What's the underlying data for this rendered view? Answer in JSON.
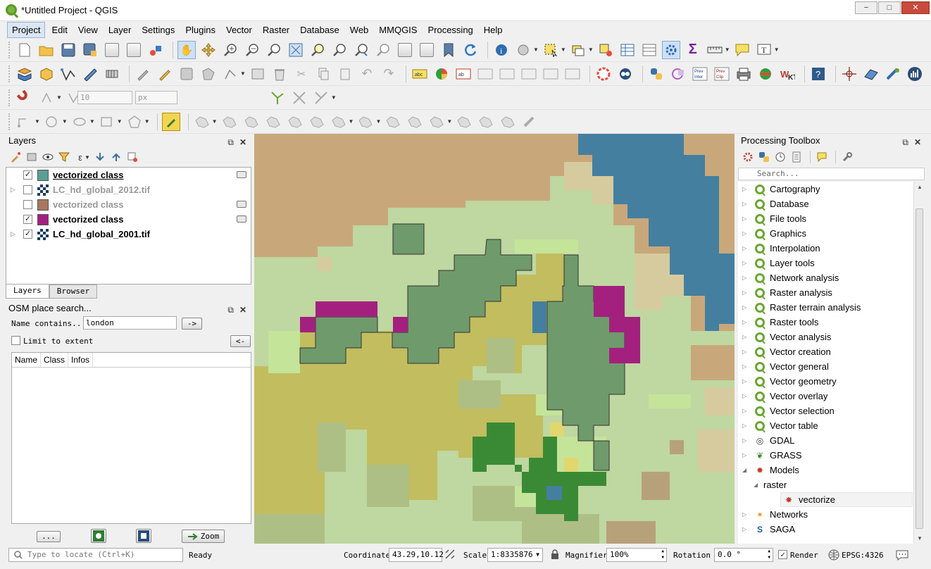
{
  "window": {
    "title": "*Untitled Project - QGIS",
    "minimize": "−",
    "maximize": "□",
    "close": "✕"
  },
  "menu": [
    "Project",
    "Edit",
    "View",
    "Layer",
    "Settings",
    "Plugins",
    "Vector",
    "Raster",
    "Database",
    "Web",
    "MMQGIS",
    "Processing",
    "Help"
  ],
  "toolbar": {
    "snapping_tolerance": "10",
    "snapping_units": "px"
  },
  "layers_panel": {
    "title": "Layers",
    "layers": [
      {
        "name": "vectorized class",
        "checked": true,
        "type": "vector",
        "color": "#5a9e95",
        "style": "bold-underline"
      },
      {
        "name": "LC_hd_global_2012.tif",
        "checked": false,
        "type": "raster",
        "style": "grey"
      },
      {
        "name": "vectorized class",
        "checked": false,
        "type": "vector",
        "color": "#a8775e",
        "style": "grey"
      },
      {
        "name": "vectorized class",
        "checked": true,
        "type": "vector",
        "color": "#a3207f",
        "style": "bold"
      },
      {
        "name": "LC_hd_global_2001.tif",
        "checked": true,
        "type": "raster",
        "style": "bold"
      }
    ],
    "tabs": [
      "Layers",
      "Browser"
    ]
  },
  "osm_panel": {
    "title": "OSM place search...",
    "name_contains_label": "Name contains...",
    "name_value": "london",
    "search_button": "->",
    "limit_label": "Limit to extent",
    "back_button": "<-",
    "columns": [
      "Name",
      "Class",
      "Infos"
    ],
    "more_button": "...",
    "zoom_button": "Zoom"
  },
  "processing": {
    "title": "Processing Toolbox",
    "search_placeholder": "Search...",
    "items": [
      {
        "label": "Cartography",
        "icon": "qgis"
      },
      {
        "label": "Database",
        "icon": "qgis"
      },
      {
        "label": "File tools",
        "icon": "qgis"
      },
      {
        "label": "Graphics",
        "icon": "qgis"
      },
      {
        "label": "Interpolation",
        "icon": "qgis"
      },
      {
        "label": "Layer tools",
        "icon": "qgis"
      },
      {
        "label": "Network analysis",
        "icon": "qgis"
      },
      {
        "label": "Raster analysis",
        "icon": "qgis"
      },
      {
        "label": "Raster terrain analysis",
        "icon": "qgis"
      },
      {
        "label": "Raster tools",
        "icon": "qgis"
      },
      {
        "label": "Vector analysis",
        "icon": "qgis"
      },
      {
        "label": "Vector creation",
        "icon": "qgis"
      },
      {
        "label": "Vector general",
        "icon": "qgis"
      },
      {
        "label": "Vector geometry",
        "icon": "qgis"
      },
      {
        "label": "Vector overlay",
        "icon": "qgis"
      },
      {
        "label": "Vector selection",
        "icon": "qgis"
      },
      {
        "label": "Vector table",
        "icon": "qgis"
      },
      {
        "label": "GDAL",
        "icon": "gdal"
      },
      {
        "label": "GRASS",
        "icon": "grass"
      },
      {
        "label": "Models",
        "icon": "models"
      }
    ],
    "models_group": "raster",
    "model_item": "vectorize",
    "bottom_items": [
      {
        "label": "Networks",
        "icon": "networks"
      },
      {
        "label": "SAGA",
        "icon": "saga"
      }
    ]
  },
  "statusbar": {
    "locate_placeholder": "Type to locate (Ctrl+K)",
    "ready": "Ready",
    "coordinate_label": "Coordinate",
    "coordinate_value": "43.29,10.12",
    "scale_label": "Scale",
    "scale_value": "1:8335876",
    "magnifier_label": "Magnifier",
    "magnifier_value": "100%",
    "rotation_label": "Rotation",
    "rotation_value": "0.0 °",
    "render_label": "Render",
    "crs": "EPSG:4326"
  },
  "colors": {
    "veg_dark": "#6f9a6b",
    "magenta": "#a3207f",
    "water": "#457fa0",
    "tan": "#c8a87b",
    "olive": "#c2bd5e",
    "light_green": "#bfd7a0"
  }
}
